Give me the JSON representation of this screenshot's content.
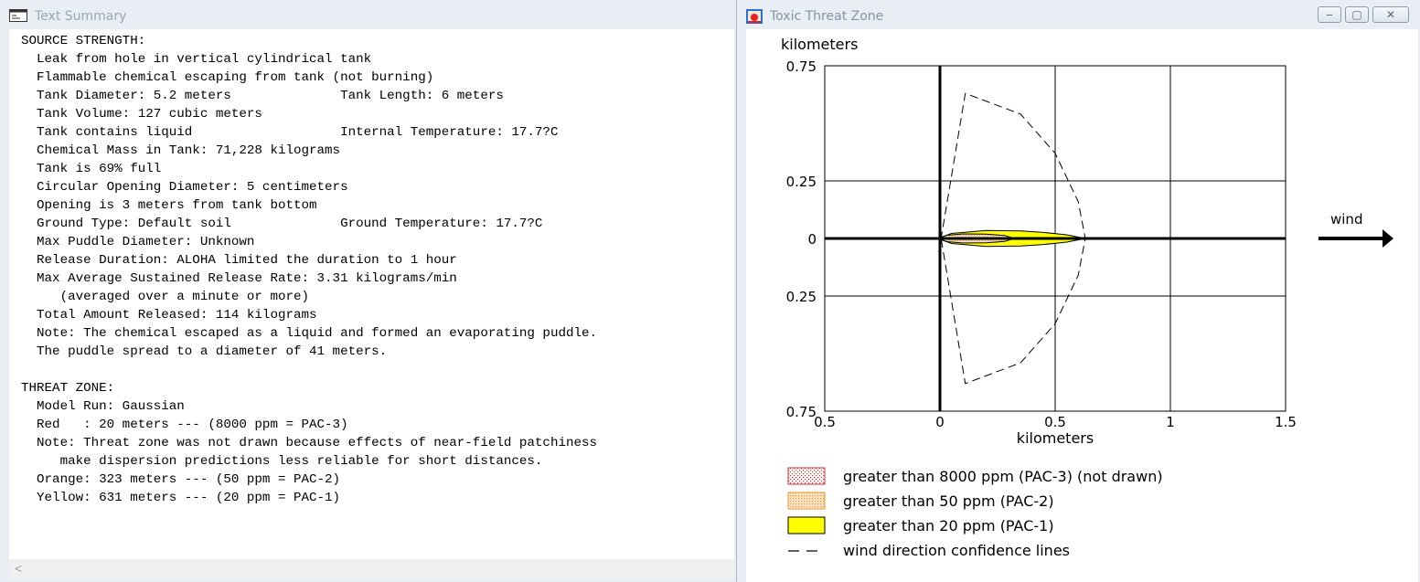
{
  "summary_window": {
    "title": "Text Summary",
    "lines": [
      "SOURCE STRENGTH:",
      "  Leak from hole in vertical cylindrical tank",
      "  Flammable chemical escaping from tank (not burning)",
      "  Tank Diameter: 5.2 meters              Tank Length: 6 meters",
      "  Tank Volume: 127 cubic meters",
      "  Tank contains liquid                   Internal Temperature: 17.7?C",
      "  Chemical Mass in Tank: 71,228 kilograms",
      "  Tank is 69% full",
      "  Circular Opening Diameter: 5 centimeters",
      "  Opening is 3 meters from tank bottom",
      "  Ground Type: Default soil              Ground Temperature: 17.7?C",
      "  Max Puddle Diameter: Unknown",
      "  Release Duration: ALOHA limited the duration to 1 hour",
      "  Max Average Sustained Release Rate: 3.31 kilograms/min",
      "     (averaged over a minute or more)",
      "  Total Amount Released: 114 kilograms",
      "  Note: The chemical escaped as a liquid and formed an evaporating puddle.",
      "  The puddle spread to a diameter of 41 meters.",
      "",
      "THREAT ZONE:",
      "  Model Run: Gaussian",
      "  Red   : 20 meters --- (8000 ppm = PAC-3)",
      "  Note: Threat zone was not drawn because effects of near-field patchiness",
      "     make dispersion predictions less reliable for short distances.",
      "  Orange: 323 meters --- (50 ppm = PAC-2)",
      "  Yellow: 631 meters --- (20 ppm = PAC-1)"
    ],
    "scroll_left_glyph": "<"
  },
  "threat_window": {
    "title": "Toxic Threat Zone",
    "buttons": {
      "minimize": "‒",
      "maximize": "▢",
      "close": "✕"
    },
    "wind_label": "wind"
  },
  "chart_data": {
    "type": "area",
    "xlabel": "kilometers",
    "ylabel": "kilometers",
    "xlim": [
      -0.5,
      1.5
    ],
    "ylim": [
      -0.75,
      0.75
    ],
    "x_ticks": [
      {
        "value": -0.5,
        "label": "0.5"
      },
      {
        "value": 0,
        "label": "0"
      },
      {
        "value": 0.5,
        "label": "0.5"
      },
      {
        "value": 1,
        "label": "1"
      },
      {
        "value": 1.5,
        "label": "1.5"
      }
    ],
    "y_ticks": [
      {
        "value": 0.75,
        "label": "0.75"
      },
      {
        "value": 0.25,
        "label": "0.25"
      },
      {
        "value": 0,
        "label": "0"
      },
      {
        "value": -0.25,
        "label": "0.25"
      },
      {
        "value": -0.75,
        "label": "0.75"
      }
    ],
    "grid": true,
    "zones": [
      {
        "name": "PAC-1",
        "color": "#ffff00",
        "extent_km": 0.631,
        "outline": [
          [
            -0.01,
            0.0
          ],
          [
            0.05,
            0.022
          ],
          [
            0.2,
            0.035
          ],
          [
            0.35,
            0.033
          ],
          [
            0.45,
            0.026
          ],
          [
            0.55,
            0.016
          ],
          [
            0.631,
            0.0
          ],
          [
            0.55,
            -0.016
          ],
          [
            0.45,
            -0.026
          ],
          [
            0.35,
            -0.033
          ],
          [
            0.2,
            -0.035
          ],
          [
            0.05,
            -0.022
          ],
          [
            -0.01,
            0.0
          ]
        ]
      },
      {
        "name": "PAC-2",
        "color": "#f5c58a",
        "extent_km": 0.323,
        "outline": [
          [
            -0.01,
            0.0
          ],
          [
            0.03,
            0.014
          ],
          [
            0.1,
            0.02
          ],
          [
            0.2,
            0.019
          ],
          [
            0.28,
            0.013
          ],
          [
            0.323,
            0.0
          ],
          [
            0.28,
            -0.013
          ],
          [
            0.2,
            -0.019
          ],
          [
            0.1,
            -0.02
          ],
          [
            0.03,
            -0.014
          ],
          [
            -0.01,
            0.0
          ]
        ]
      }
    ],
    "confidence_lines": [
      [
        -0.005,
        -0.06
      ],
      [
        0.11,
        0.63
      ],
      [
        0.35,
        0.54
      ],
      [
        0.5,
        0.37
      ],
      [
        0.6,
        0.16
      ],
      [
        0.631,
        0.0
      ],
      [
        0.6,
        -0.16
      ],
      [
        0.5,
        -0.37
      ],
      [
        0.35,
        -0.54
      ],
      [
        0.11,
        -0.63
      ],
      [
        -0.005,
        0.06
      ]
    ],
    "legend": [
      {
        "label": "greater than 8000 ppm (PAC-3) (not drawn)",
        "swatch": "red-dotted"
      },
      {
        "label": "greater than 50 ppm (PAC-2)",
        "swatch": "orange-dotted"
      },
      {
        "label": "greater than 20 ppm (PAC-1)",
        "swatch": "yellow"
      },
      {
        "label": "wind direction confidence lines",
        "swatch": "dashed"
      }
    ],
    "legend_placement": "bottom-left"
  }
}
